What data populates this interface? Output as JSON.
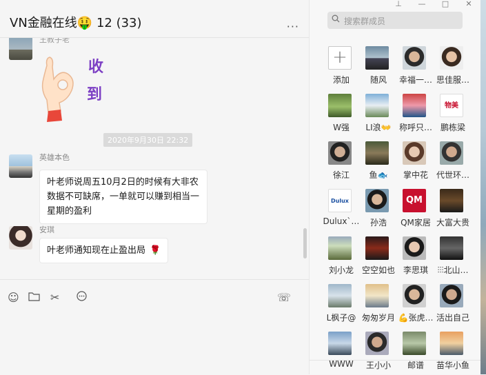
{
  "chat": {
    "title": "VN金融在线",
    "title_emoji": "🤑",
    "count": "12 (33)",
    "more": "···",
    "messages_top_sender": "王教子老",
    "sticker_chars": [
      "收",
      "到"
    ],
    "timestamp": "2020年9月30日 22:32",
    "msg1": {
      "sender": "英雄本色",
      "text": "叶老师说周五10月2日的时候有大非农数据不可缺席，一单就可以赚到相当一星期的盈利"
    },
    "msg2": {
      "sender": "安琪",
      "text": "叶老师通知现在止盈出局",
      "emoji": "🌹"
    }
  },
  "window_controls": {
    "pin": "⊥",
    "minimize": "—",
    "maximize": "□",
    "close": "✕"
  },
  "toolbar": {
    "emoji": "☺",
    "folder": "▭",
    "scissors": "✂",
    "chat": "💬",
    "video": "☏"
  },
  "members": {
    "search_placeholder": "搜索群成员",
    "add_label": "添加",
    "list": [
      "随风",
      "幸福一…",
      "思佳服…",
      "W强",
      "LI浪👐",
      "称呼只…",
      "鹏栋梁",
      "徐江",
      "鱼🐟",
      "掌中花",
      "代世环…",
      "Dulux`…",
      "孙浩",
      "QM家居",
      "大富大贵",
      "刘小龙",
      "空空如也",
      "李思琪",
      "⫶⫶⫶北山…",
      "L枫子@",
      "匆匆岁月",
      "💪张虎…",
      "活出自己",
      "WWW",
      "王小小",
      "邮谱",
      "苗华小鱼"
    ]
  },
  "member_logos": {
    "Dulux": "Dulux",
    "QM": "QM",
    "wumart": "物美"
  }
}
